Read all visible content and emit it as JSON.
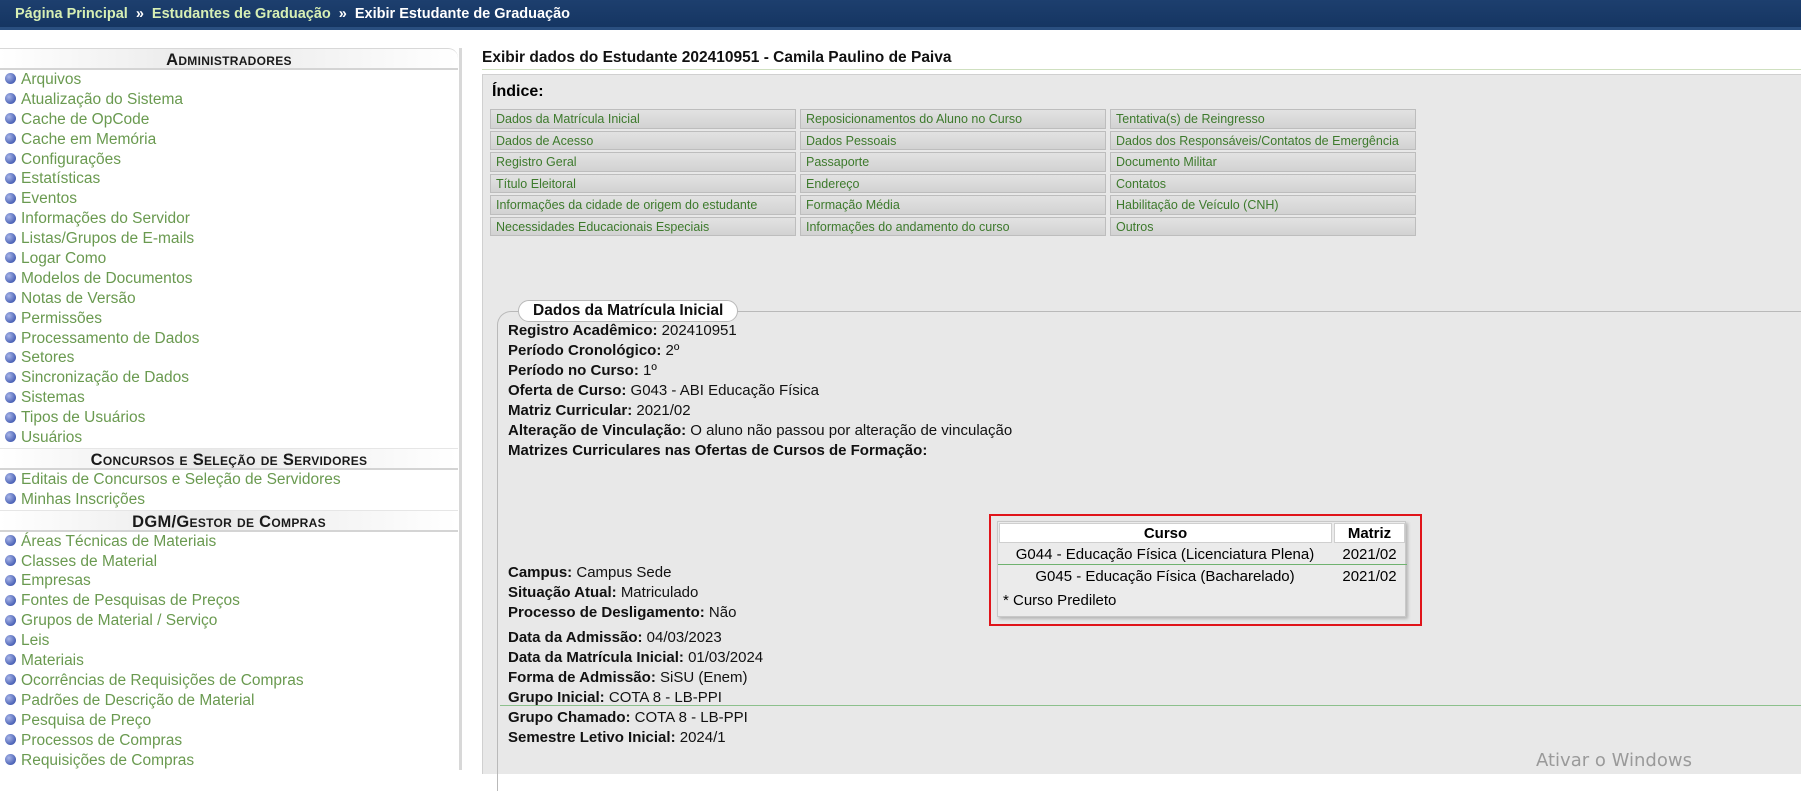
{
  "breadcrumb": {
    "home": "Página Principal",
    "parent": "Estudantes de Graduação",
    "current": "Exibir Estudante de Graduação",
    "separator": "»"
  },
  "sidebar": {
    "groups": [
      {
        "title": "Administradores",
        "items": [
          "Arquivos",
          "Atualização do Sistema",
          "Cache de OpCode",
          "Cache em Memória",
          "Configurações",
          "Estatísticas",
          "Eventos",
          "Informações do Servidor",
          "Listas/Grupos de E-mails",
          "Logar Como",
          "Modelos de Documentos",
          "Notas de Versão",
          "Permissões",
          "Processamento de Dados",
          "Setores",
          "Sincronização de Dados",
          "Sistemas",
          "Tipos de Usuários",
          "Usuários"
        ]
      },
      {
        "title": "Concursos e Seleção de Servidores",
        "items": [
          "Editais de Concursos e Seleção de Servidores",
          "Minhas Inscrições"
        ]
      },
      {
        "title": "DGM/Gestor de Compras",
        "items": [
          "Áreas Técnicas de Materiais",
          "Classes de Material",
          "Empresas",
          "Fontes de Pesquisas de Preços",
          "Grupos de Material / Serviço",
          "Leis",
          "Materiais",
          "Ocorrências de Requisições de Compras",
          "Padrões de Descrição de Material",
          "Pesquisa de Preço",
          "Processos de Compras",
          "Requisições de Compras"
        ]
      }
    ]
  },
  "main": {
    "title": "Exibir dados do Estudante 202410951 - Camila Paulino de Paiva",
    "indice_label": "Índice:",
    "indice_links": [
      "Dados da Matrícula Inicial",
      "Reposicionamentos do Aluno no Curso",
      "Tentativa(s) de Reingresso",
      "Dados de Acesso",
      "Dados Pessoais",
      "Dados dos Responsáveis/Contatos de Emergência",
      "Registro Geral",
      "Passaporte",
      "Documento Militar",
      "Título Eleitoral",
      "Endereço",
      "Contatos",
      "Informações da cidade de origem do estudante",
      "Formação Média",
      "Habilitação de Veículo (CNH)",
      "Necessidades Educacionais Especiais",
      "Informações do andamento do curso",
      "Outros"
    ],
    "section_title": "Dados da Matrícula Inicial",
    "fields": [
      {
        "label": "Registro Acadêmico:",
        "value": "202410951"
      },
      {
        "label": "Período Cronológico:",
        "value": "2º"
      },
      {
        "label": "Período no Curso:",
        "value": "1º"
      },
      {
        "label": "Oferta de Curso:",
        "value": "G043 - ABI Educação Física"
      },
      {
        "label": "Matriz Curricular:",
        "value": "2021/02"
      },
      {
        "label": "Alteração de Vinculação:",
        "value": "O aluno não passou por alteração de vinculação"
      },
      {
        "label": "Matrizes Curriculares nas Ofertas de Cursos de Formação:",
        "value": ""
      }
    ],
    "matrizes_table": {
      "headers": [
        "Curso",
        "Matriz"
      ],
      "rows": [
        [
          "G044 - Educação Física (Licenciatura Plena)",
          "2021/02"
        ],
        [
          "G045 - Educação Física (Bacharelado)",
          "2021/02"
        ]
      ],
      "note": "* Curso Predileto"
    },
    "fields2": [
      {
        "label": "Campus:",
        "value": "Campus Sede"
      },
      {
        "label": "Situação Atual:",
        "value": "Matriculado"
      },
      {
        "label": "Processo de Desligamento:",
        "value": "Não"
      }
    ],
    "fields3": [
      {
        "label": "Data da Admissão:",
        "value": "04/03/2023"
      },
      {
        "label": "Data da Matrícula Inicial:",
        "value": "01/03/2024"
      },
      {
        "label": "Forma de Admissão:",
        "value": "SiSU (Enem)"
      },
      {
        "label": "Grupo Inicial:",
        "value": "COTA 8 - LB-PPI"
      },
      {
        "label": "Grupo Chamado:",
        "value": "COTA 8 - LB-PPI"
      },
      {
        "label": "Semestre Letivo Inicial:",
        "value": "2024/1"
      }
    ]
  },
  "watermark": "Ativar o Windows",
  "colors": {
    "topbar": "#1d3f6e",
    "link_green": "#6a9a50",
    "highlight_red": "#e0141a"
  }
}
